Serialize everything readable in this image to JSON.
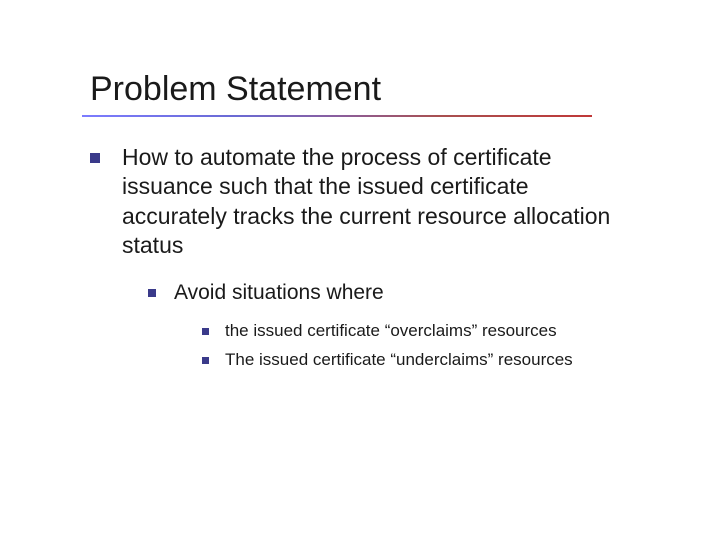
{
  "slide": {
    "title": "Problem Statement",
    "level1": {
      "text": "How to automate the process of certificate issuance such that the issued certificate accurately tracks the current resource allocation status"
    },
    "level2": {
      "text": "Avoid situations where"
    },
    "level3": [
      {
        "text": "the issued certificate “overclaims” resources"
      },
      {
        "text": "The issued certificate “underclaims” resources"
      }
    ]
  }
}
